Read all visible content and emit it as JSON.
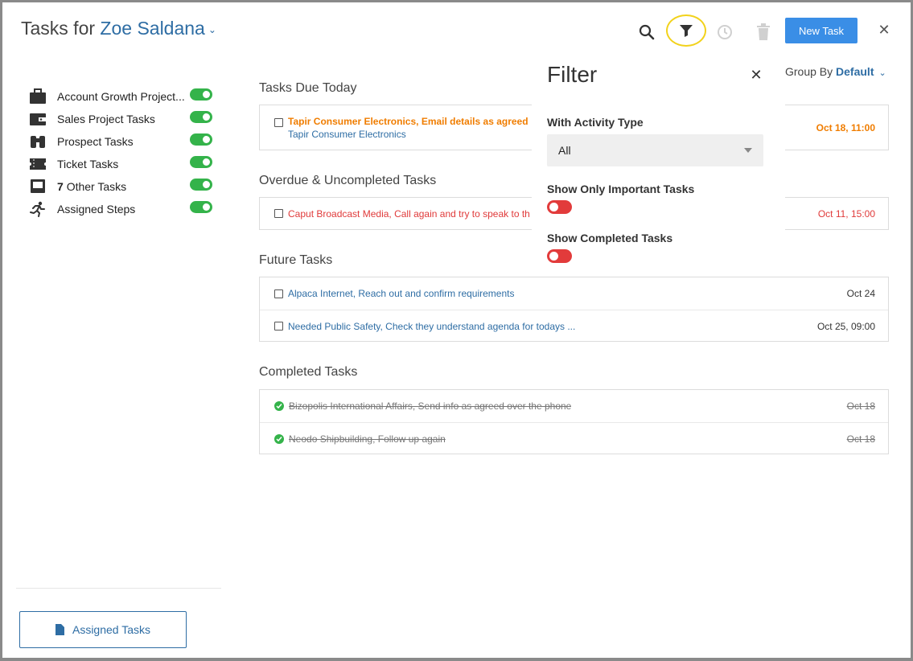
{
  "header": {
    "title_prefix": "Tasks for",
    "user_name": "Zoe Saldana",
    "new_task_label": "New Task"
  },
  "sidebar": {
    "items": [
      {
        "label": "Account Growth Project...",
        "icon": "briefcase-icon",
        "enabled": true
      },
      {
        "label": "Sales Project Tasks",
        "icon": "wallet-icon",
        "enabled": true
      },
      {
        "label": "Prospect Tasks",
        "icon": "binoculars-icon",
        "enabled": true
      },
      {
        "label": "Ticket Tasks",
        "icon": "ticket-icon",
        "enabled": true
      },
      {
        "count": "7",
        "label": "Other Tasks",
        "icon": "inbox-icon",
        "enabled": true
      },
      {
        "label": "Assigned Steps",
        "icon": "running-icon",
        "enabled": true
      }
    ],
    "assigned_button_label": "Assigned Tasks"
  },
  "groupby": {
    "label": "Group By",
    "value": "Default"
  },
  "sections": {
    "due_today": {
      "title": "Tasks Due Today",
      "tasks": [
        {
          "text": "Tapir Consumer Electronics, Email details as agreed",
          "subtext": "Tapir Consumer Electronics",
          "date": "Oct 18, 11:00"
        }
      ]
    },
    "overdue": {
      "title": "Overdue & Uncompleted Tasks",
      "tasks": [
        {
          "text": "Caput Broadcast Media, Call again and try to speak to th",
          "date": "Oct 11, 15:00"
        }
      ]
    },
    "future": {
      "title": "Future Tasks",
      "tasks": [
        {
          "text": "Alpaca Internet, Reach out and confirm requirements",
          "date": "Oct 24"
        },
        {
          "text": "Needed Public Safety, Check they understand agenda for todays ...",
          "date": "Oct 25, 09:00"
        }
      ]
    },
    "completed": {
      "title": "Completed Tasks",
      "tasks": [
        {
          "text": "Bizopolis International Affairs, Send info as agreed over the phone",
          "date": "Oct 18"
        },
        {
          "text": "Neodo Shipbuilding, Follow up again",
          "date": "Oct 18"
        }
      ]
    }
  },
  "filter": {
    "title": "Filter",
    "activity_label": "With Activity Type",
    "activity_value": "All",
    "important_label": "Show Only Important Tasks",
    "important_on": false,
    "completed_label": "Show Completed Tasks",
    "completed_on": false
  },
  "colors": {
    "accent": "#3a8ee6",
    "link": "#2e6da4",
    "toggle_on": "#34b34a",
    "toggle_off": "#e23b3b",
    "due_today": "#f07d00",
    "overdue": "#e03a3a",
    "highlight": "#f2d21b"
  }
}
